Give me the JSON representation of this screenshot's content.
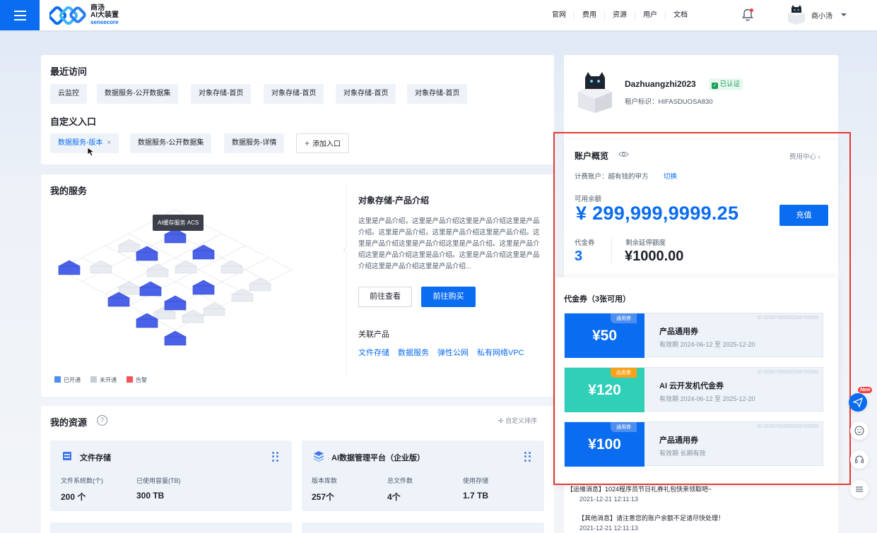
{
  "header": {
    "logo_line1": "商汤",
    "logo_line2": "AI大装置",
    "logo_line3": "sensecore",
    "nav": [
      "官网",
      "费用",
      "资源",
      "用户",
      "文档"
    ],
    "username": "商小汤"
  },
  "recent": {
    "title": "最近访问",
    "items": [
      "云监控",
      "数据服务-公开数据集",
      "对象存储-首页",
      "对象存储-首页",
      "对象存储-首页",
      "对象存储-首页"
    ]
  },
  "custom": {
    "title": "自定义入口",
    "items": [
      "数据服务-版本",
      "数据服务-公开数据集",
      "数据服务-详情"
    ],
    "close_glyph": "×",
    "add_label": "添加入口"
  },
  "services": {
    "title": "我的服务",
    "tooltip": "AI缓存服务 ACS",
    "legend": [
      {
        "label": "已开通",
        "color": "#4e8ef0"
      },
      {
        "label": "未开通",
        "color": "#c5cdd8"
      },
      {
        "label": "告警",
        "color": "#f2545b"
      }
    ],
    "product_title": "对象存储-产品介绍",
    "product_desc": "这里是产品介绍，这里是产品介绍这里是产品介绍这里是产品介绍。这里是产品介绍，这里是产品介绍这里是产品介绍。这里是产品介绍这里是产品介绍这里是产品介绍。这里是产品介绍这里是产品介绍这里是品介绍。这里是产品介绍这里是产品介绍这里是产品介绍这里是产品介绍...",
    "btn_view": "前往查看",
    "btn_buy": "前往购买",
    "related_title": "关联产品",
    "related": [
      "文件存储",
      "数据服务",
      "弹性公网",
      "私有网络VPC"
    ]
  },
  "resources": {
    "title": "我的资源",
    "help_glyph": "?",
    "sort_label": "自定义排序",
    "cards": [
      {
        "name": "文件存储",
        "stats": [
          {
            "label": "文件系统数(个)",
            "value": "200 个"
          },
          {
            "label": "已使用容量(TB)",
            "value": "300 TB"
          }
        ]
      },
      {
        "name": "AI数据管理平台（企业版）",
        "stats": [
          {
            "label": "版本库数",
            "value": "257个"
          },
          {
            "label": "总文件数",
            "value": "4个"
          },
          {
            "label": "使用存储",
            "value": "1.7 TB"
          }
        ]
      }
    ]
  },
  "profile": {
    "name": "Dazhuangzhi2023",
    "verified": "已认证",
    "tenant": "租户标识：HIFASDUOSA830"
  },
  "account": {
    "title": "账户概览",
    "fee_center": "费用中心",
    "billing_account": "计费账户：超有钱的甲方",
    "switch": "切换",
    "balance_label": "可用余额",
    "balance": "¥ 299,999,9999.25",
    "recharge": "充值",
    "voucher_label": "代金券",
    "voucher_count": "3",
    "deferral_label": "剩余延停额度",
    "deferral": "¥1000.00"
  },
  "vouchers": {
    "title": "代金券（3张可用）",
    "items": [
      {
        "amount": "¥50",
        "badge": "通用券",
        "name": "产品通用券",
        "validity": "有效期 2024-06-12 至 2025-12-20",
        "id": "ID 02087000000208700098",
        "color": "#0a6cf0",
        "badge_color": "#4e8ef0"
      },
      {
        "amount": "¥120",
        "badge": "品类券",
        "name": "AI 云开发机代金券",
        "validity": "有效期 2024-06-12 至 2025-12-20",
        "id": "ID 02087000000208700098",
        "color": "#2fcfb8",
        "badge_color": "#f7a21b"
      },
      {
        "amount": "¥100",
        "badge": "通用券",
        "name": "产品通用券",
        "validity": "有效期 长期有效",
        "id": "ID 02087000000208700098",
        "color": "#0a6cf0",
        "badge_color": "#4e8ef0"
      }
    ]
  },
  "messages": [
    {
      "text": "【运维消息】1024程序员节日礼券礼包快来领取吧~",
      "time": "2021-12-21  12:11:13"
    },
    {
      "text": "【其他消息】请注意您的账户余额不足请尽快处理！",
      "time": "2021-12-21  12:11:13"
    }
  ],
  "side": {
    "new_badge": "New"
  }
}
